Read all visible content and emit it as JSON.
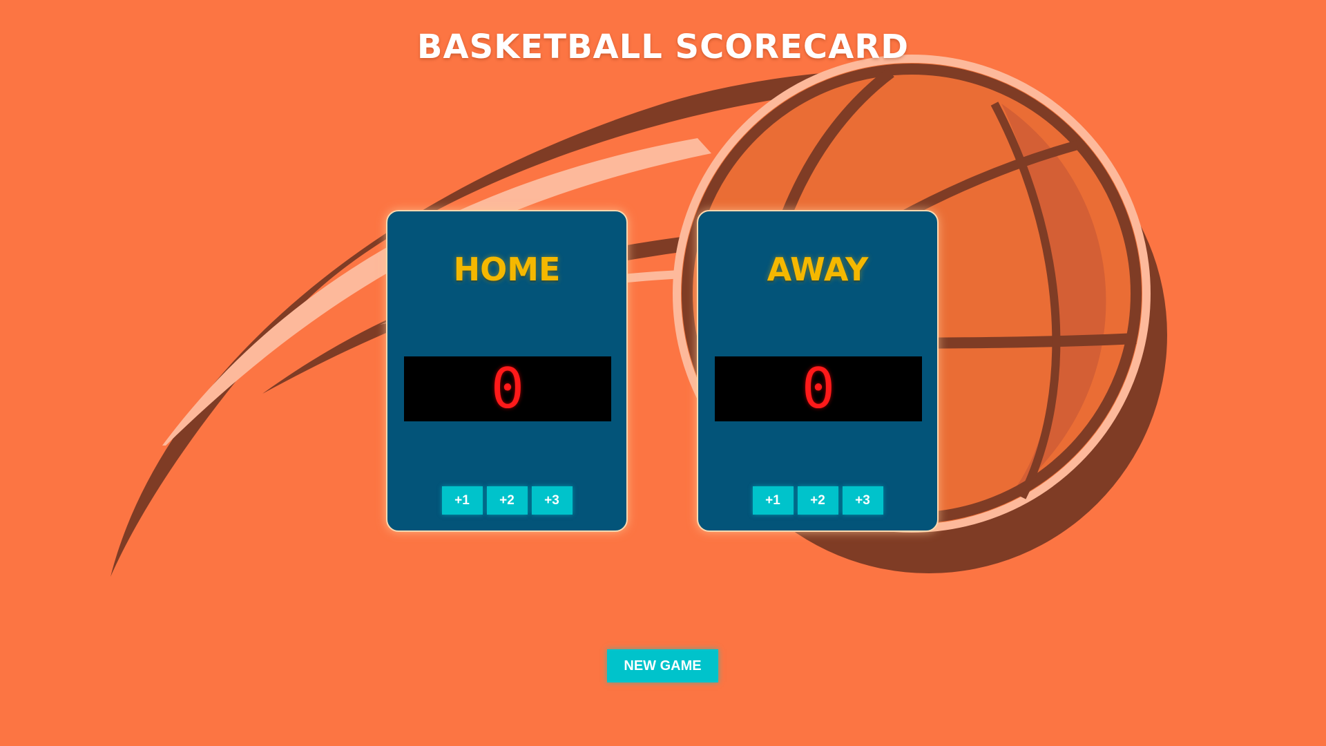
{
  "app": {
    "title": "BASKETBALL SCORECARD"
  },
  "home": {
    "name": "HOME",
    "score": "0",
    "buttons": [
      "+1",
      "+2",
      "+3"
    ]
  },
  "away": {
    "name": "AWAY",
    "score": "0",
    "buttons": [
      "+1",
      "+2",
      "+3"
    ]
  },
  "controls": {
    "new_game_label": "NEW GAME"
  },
  "colors": {
    "background": "#fc7543",
    "panel": "#035479",
    "team_name": "#f5b800",
    "score_digits": "#ff1a1a",
    "button": "#00c3cb"
  },
  "icons": {
    "background_art": "basketball-icon"
  }
}
